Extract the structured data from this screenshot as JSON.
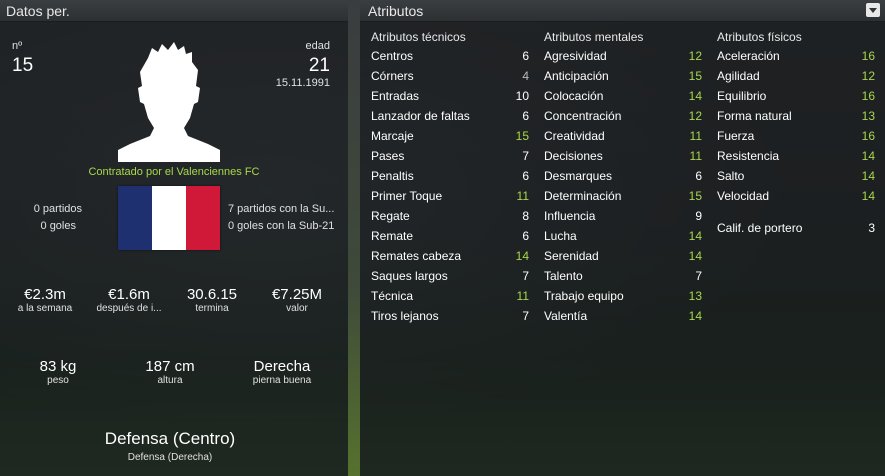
{
  "left_panel": {
    "title": "Datos per.",
    "number_label": "nº",
    "number": "15",
    "age_label": "edad",
    "age": "21",
    "birthdate": "15.11.1991",
    "contract_text": "Contratado por el Valenciennes FC",
    "nat_apps": "0 partidos",
    "nat_goals": "0 goles",
    "u21_apps": "7 partidos con la Su...",
    "u21_goals": "0 goles con la Sub-21",
    "flag_colors": [
      "#1e3070",
      "#ffffff",
      "#d01838"
    ],
    "finance": [
      {
        "value": "€2.3m",
        "label": "a la semana"
      },
      {
        "value": "€1.6m",
        "label": "después de i..."
      },
      {
        "value": "30.6.15",
        "label": "termina"
      },
      {
        "value": "€7.25M",
        "label": "valor"
      }
    ],
    "physical": [
      {
        "value": "83 kg",
        "label": "peso"
      },
      {
        "value": "187 cm",
        "label": "altura"
      },
      {
        "value": "Derecha",
        "label": "pierna buena"
      }
    ],
    "position": "Defensa (Centro)",
    "secondary_position": "Defensa (Derecha)"
  },
  "right_panel": {
    "title": "Atributos",
    "technical": {
      "title": "Atributos técnicos",
      "items": [
        {
          "label": "Centros",
          "value": "6"
        },
        {
          "label": "Córners",
          "value": "4"
        },
        {
          "label": "Entradas",
          "value": "10"
        },
        {
          "label": "Lanzador de faltas",
          "value": "6"
        },
        {
          "label": "Marcaje",
          "value": "15"
        },
        {
          "label": "Pases",
          "value": "7"
        },
        {
          "label": "Penaltis",
          "value": "6"
        },
        {
          "label": "Primer Toque",
          "value": "11"
        },
        {
          "label": "Regate",
          "value": "8"
        },
        {
          "label": "Remate",
          "value": "6"
        },
        {
          "label": "Remates cabeza",
          "value": "14"
        },
        {
          "label": "Saques largos",
          "value": "7"
        },
        {
          "label": "Técnica",
          "value": "11"
        },
        {
          "label": "Tiros lejanos",
          "value": "7"
        }
      ]
    },
    "mental": {
      "title": "Atributos mentales",
      "items": [
        {
          "label": "Agresividad",
          "value": "12"
        },
        {
          "label": "Anticipación",
          "value": "15"
        },
        {
          "label": "Colocación",
          "value": "14"
        },
        {
          "label": "Concentración",
          "value": "12"
        },
        {
          "label": "Creatividad",
          "value": "11"
        },
        {
          "label": "Decisiones",
          "value": "11"
        },
        {
          "label": "Desmarques",
          "value": "6"
        },
        {
          "label": "Determinación",
          "value": "15"
        },
        {
          "label": "Influencia",
          "value": "9"
        },
        {
          "label": "Lucha",
          "value": "14"
        },
        {
          "label": "Serenidad",
          "value": "14"
        },
        {
          "label": "Talento",
          "value": "7"
        },
        {
          "label": "Trabajo equipo",
          "value": "13"
        },
        {
          "label": "Valentía",
          "value": "14"
        }
      ]
    },
    "physical": {
      "title": "Atributos físicos",
      "items": [
        {
          "label": "Aceleración",
          "value": "16"
        },
        {
          "label": "Agilidad",
          "value": "12"
        },
        {
          "label": "Equilibrio",
          "value": "16"
        },
        {
          "label": "Forma natural",
          "value": "13"
        },
        {
          "label": "Fuerza",
          "value": "16"
        },
        {
          "label": "Resistencia",
          "value": "14"
        },
        {
          "label": "Salto",
          "value": "14"
        },
        {
          "label": "Velocidad",
          "value": "14"
        }
      ],
      "goalkeeper_label": "Calif. de portero",
      "goalkeeper_value": "3"
    }
  }
}
